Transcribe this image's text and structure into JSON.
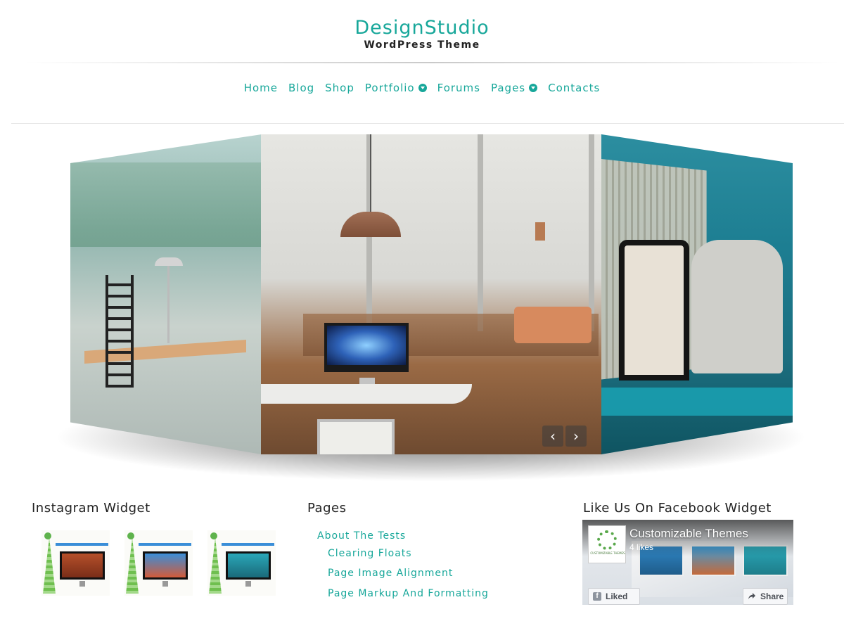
{
  "site": {
    "title": "DesignStudio",
    "tagline": "WordPress Theme",
    "accent_color": "#17a79a"
  },
  "nav": {
    "items": [
      {
        "label": "Home",
        "has_dropdown": false
      },
      {
        "label": "Blog",
        "has_dropdown": false
      },
      {
        "label": "Shop",
        "has_dropdown": false
      },
      {
        "label": "Portfolio",
        "has_dropdown": true
      },
      {
        "label": "Forums",
        "has_dropdown": false
      },
      {
        "label": "Pages",
        "has_dropdown": true
      },
      {
        "label": "Contacts",
        "has_dropdown": false
      }
    ],
    "dropdown_icon": "circle-arrow-down-icon"
  },
  "slider": {
    "prev_icon": "chevron-left-icon",
    "next_icon": "chevron-right-icon",
    "prev_glyph": "‹",
    "next_glyph": "›"
  },
  "widgets": {
    "instagram": {
      "title": "Instagram Widget",
      "thumbnails": 3
    },
    "pages": {
      "title": "Pages",
      "items": [
        {
          "label": "About The Tests",
          "level": 0
        },
        {
          "label": "Clearing Floats",
          "level": 1
        },
        {
          "label": "Page Image Alignment",
          "level": 1
        },
        {
          "label": "Page Markup And Formatting",
          "level": 1
        }
      ]
    },
    "facebook": {
      "title": "Like Us On Facebook Widget",
      "page_name": "Customizable Themes",
      "likes": "4 likes",
      "liked_label": "Liked",
      "share_label": "Share",
      "avatar_text": "CUSTOMIZABLE THEMES",
      "brand_color": "#3b5998"
    }
  }
}
